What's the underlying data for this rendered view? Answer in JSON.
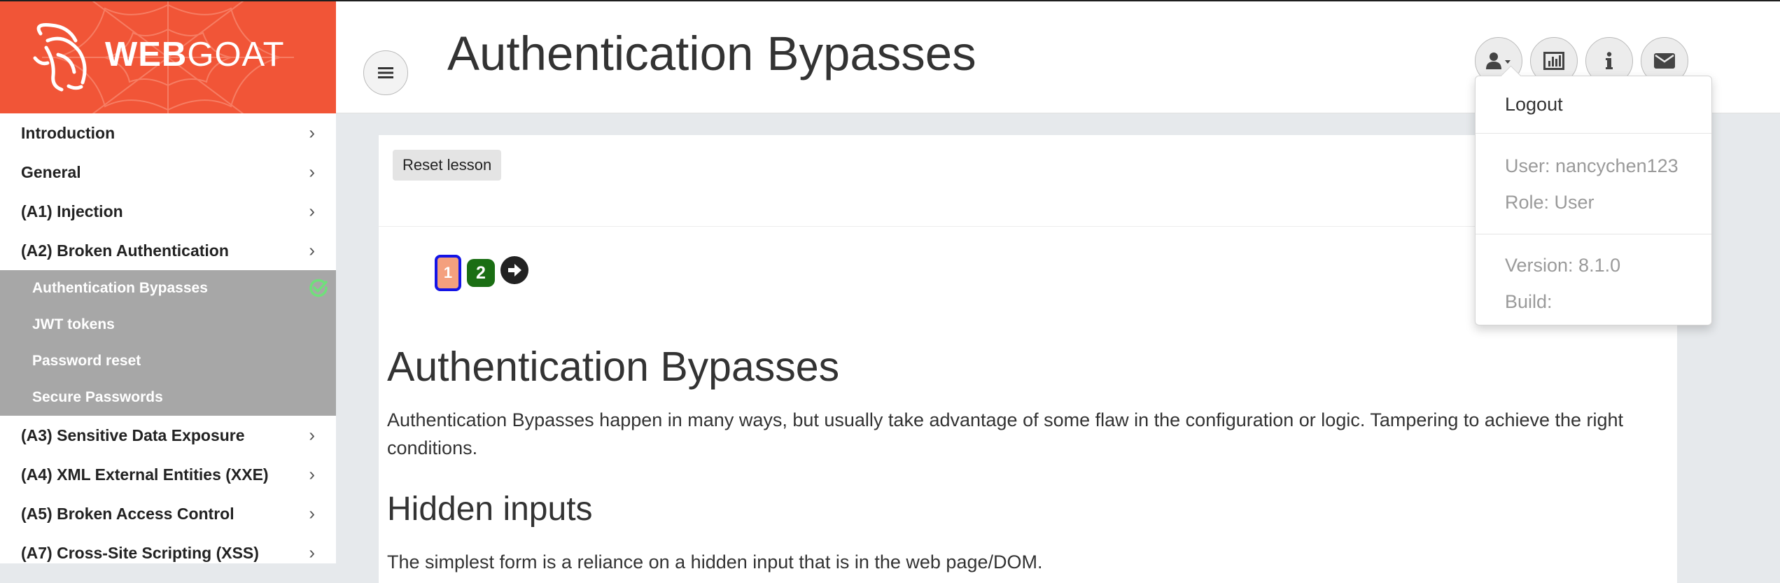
{
  "brand": {
    "name_bold": "WEB",
    "name_light": "GOAT"
  },
  "header": {
    "title": "Authentication Bypasses"
  },
  "icons": {
    "menu": "hamburger-icon",
    "user": "user-icon",
    "report": "bar-chart-icon",
    "about": "info-icon",
    "contact": "envelope-icon"
  },
  "sidebar": {
    "categories_top": [
      {
        "label": "Introduction"
      },
      {
        "label": "General"
      },
      {
        "label": "(A1) Injection"
      },
      {
        "label": "(A2) Broken Authentication"
      }
    ],
    "subitems": [
      {
        "label": "Authentication Bypasses",
        "completed": true
      },
      {
        "label": "JWT tokens"
      },
      {
        "label": "Password reset"
      },
      {
        "label": "Secure Passwords"
      }
    ],
    "categories_bottom": [
      {
        "label": "(A3) Sensitive Data Exposure"
      },
      {
        "label": "(A4) XML External Entities (XXE)"
      },
      {
        "label": "(A5) Broken Access Control"
      },
      {
        "label": "(A7) Cross-Site Scripting (XSS)"
      }
    ]
  },
  "lesson": {
    "reset_label": "Reset lesson",
    "pages": [
      {
        "number": "1"
      },
      {
        "number": "2"
      }
    ],
    "heading": "Authentication Bypasses",
    "intro": "Authentication Bypasses happen in many ways, but usually take advantage of some flaw in the configuration or logic. Tampering to achieve the right conditions.",
    "subheading": "Hidden inputs",
    "para2": "The simplest form is a reliance on a hidden input that is in the web page/DOM."
  },
  "user_menu": {
    "logout": "Logout",
    "user": "User: nancychen123",
    "role": "Role: User",
    "version": "Version: 8.1.0",
    "build": "Build:"
  },
  "colors": {
    "brand": "#f15537",
    "submenu_bg": "#a7a7a7",
    "complete_check": "#6fe07a",
    "page_current_border": "#1414e6",
    "page_current_fill": "#f4a07e",
    "page_done": "#1a6e13"
  }
}
